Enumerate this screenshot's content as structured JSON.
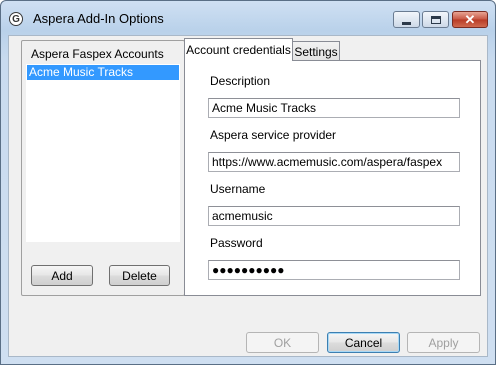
{
  "window": {
    "title": "Aspera Add-In Options",
    "app_icon_glyph": "G"
  },
  "accounts": {
    "group_title": "Aspera Faspex Accounts",
    "items": [
      {
        "label": "Acme Music Tracks",
        "selected": true
      }
    ],
    "add_label": "Add",
    "delete_label": "Delete"
  },
  "tabs": [
    {
      "label": "Account credentials",
      "active": true
    },
    {
      "label": "Settings",
      "active": false
    }
  ],
  "credentials": {
    "description_label": "Description",
    "description_value": "Acme Music Tracks",
    "provider_label": "Aspera service provider",
    "provider_value": "https://www.acmemusic.com/aspera/faspex",
    "username_label": "Username",
    "username_value": "acmemusic",
    "password_label": "Password",
    "password_value": "●●●●●●●●●●"
  },
  "footer": {
    "ok_label": "OK",
    "cancel_label": "Cancel",
    "apply_label": "Apply"
  },
  "icons": {
    "app": "aspera-app-icon",
    "minimize": "minimize-icon",
    "maximize": "maximize-icon",
    "close": "close-icon"
  },
  "colors": {
    "selection": "#3399ff",
    "close_button": "#c75441",
    "title_bar": "#b9d1ea"
  }
}
